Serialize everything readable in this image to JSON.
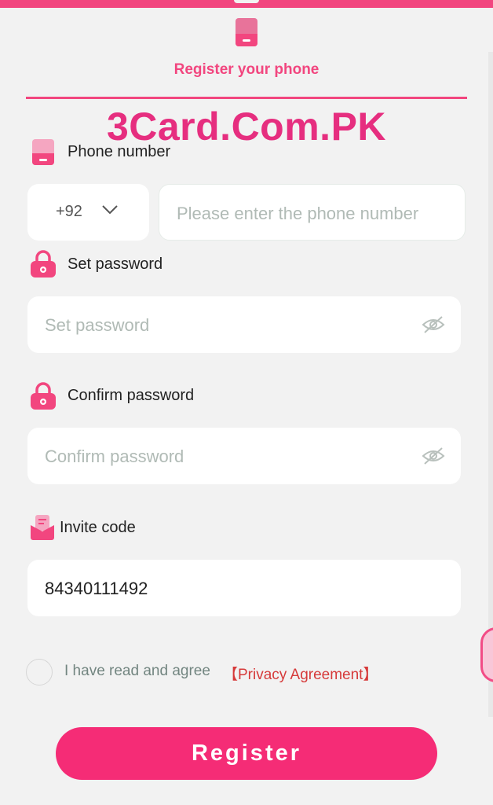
{
  "header": {
    "tab_label": "Register your phone",
    "watermark": "3Card.Com.PK"
  },
  "phone": {
    "label": "Phone number",
    "country_code": "+92",
    "placeholder": "Please enter the phone number"
  },
  "password": {
    "label": "Set password",
    "placeholder": "Set password"
  },
  "confirm_password": {
    "label": "Confirm password",
    "placeholder": "Confirm password"
  },
  "invite": {
    "label": "Invite code",
    "value": "84340111492"
  },
  "agreement": {
    "text": "I have read and agree",
    "link": "【Privacy Agreement】",
    "checked": false
  },
  "register_label": "Register",
  "icons": {
    "tab": "phone-icon",
    "phone": "phone-icon",
    "password": "lock-icon",
    "confirm": "lock-icon",
    "invite": "invite-code-icon",
    "visibility": "eye-slash-icon",
    "dropdown": "chevron-down-icon"
  },
  "colors": {
    "accent": "#f2467f",
    "button": "#f52c76",
    "link": "#d63a3a",
    "background": "#f2f2f2"
  }
}
